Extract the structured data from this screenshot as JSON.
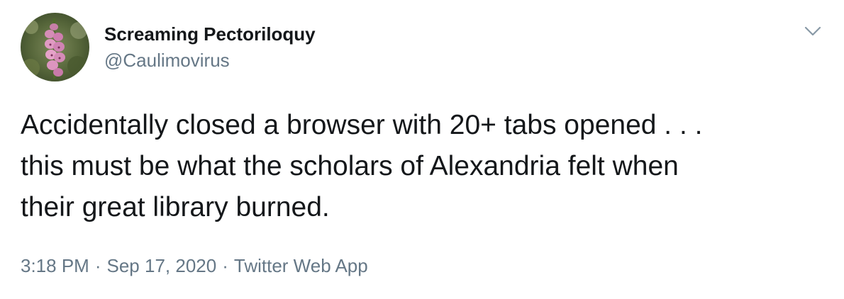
{
  "tweet": {
    "author": {
      "display_name": "Screaming Pectoriloquy",
      "handle": "@Caulimovirus",
      "avatar_icon": "foxglove-flower-avatar"
    },
    "text": "Accidentally closed a browser with 20+ tabs opened . . .\nthis must be what the scholars of Alexandria felt when\ntheir great library burned.",
    "time": "3:18 PM",
    "date": "Sep 17, 2020",
    "source": "Twitter Web App",
    "separator": "·",
    "menu_icon": "chevron-down-icon"
  },
  "colors": {
    "text_primary": "#14171a",
    "text_secondary": "#657786",
    "background": "#ffffff"
  }
}
